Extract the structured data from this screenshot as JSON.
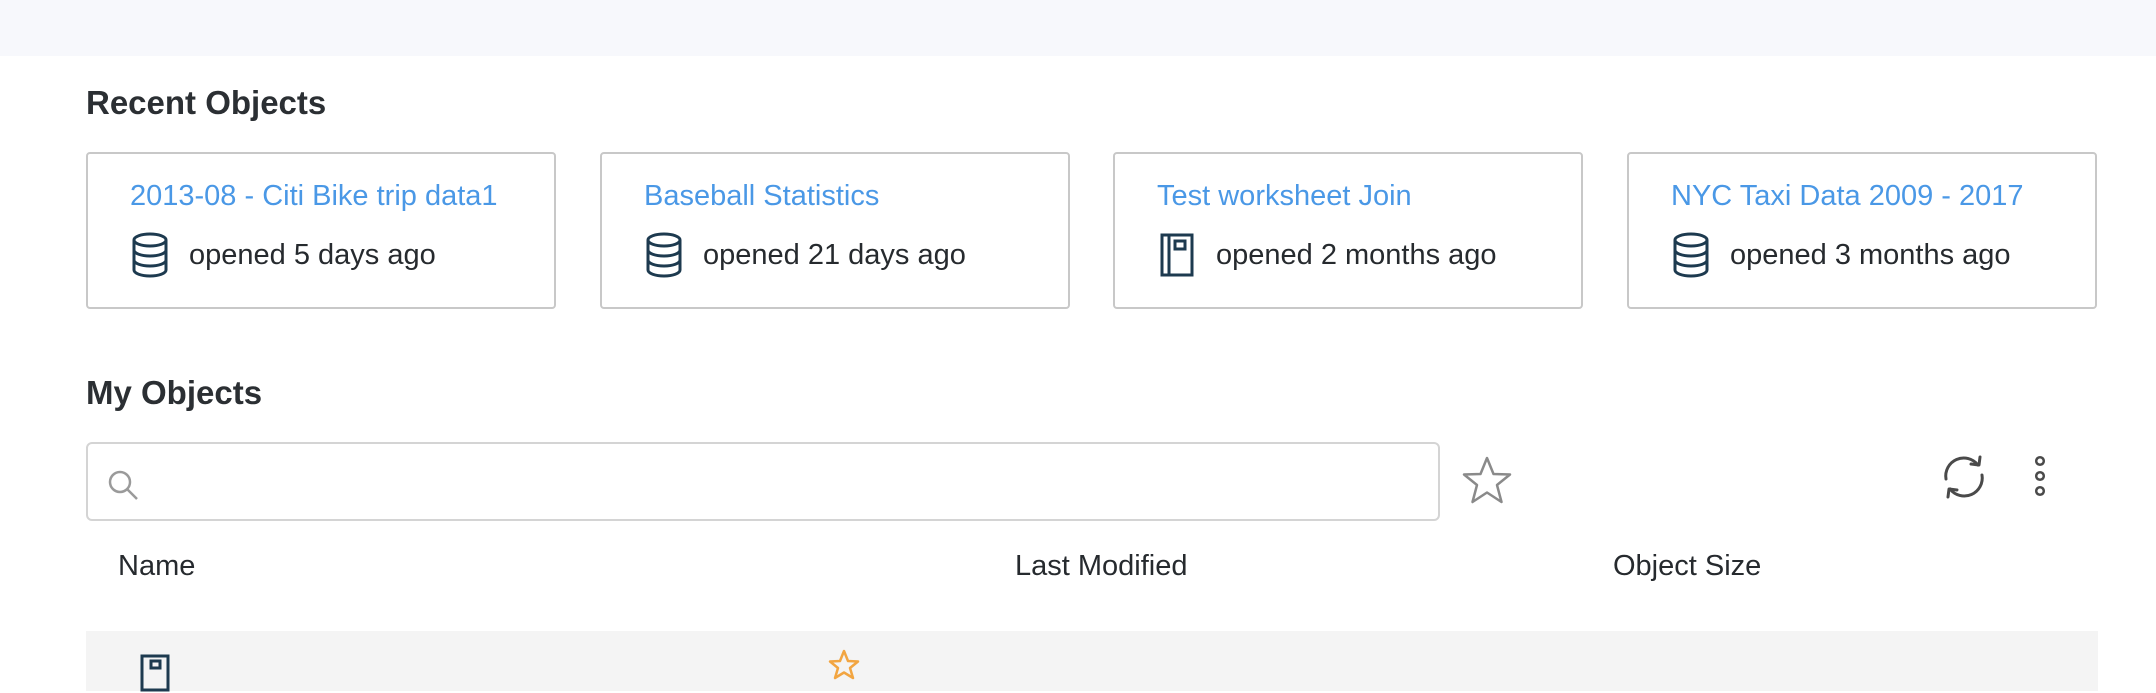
{
  "recent": {
    "title": "Recent Objects",
    "items": [
      {
        "name": "2013-08 - Citi Bike trip data1",
        "opened": "opened 5 days ago",
        "icon": "database-icon"
      },
      {
        "name": "Baseball Statistics",
        "opened": "opened 21 days ago",
        "icon": "database-icon"
      },
      {
        "name": "Test worksheet Join",
        "opened": "opened 2 months ago",
        "icon": "notebook-icon"
      },
      {
        "name": "NYC Taxi Data 2009 - 2017",
        "opened": "opened 3 months ago",
        "icon": "database-icon"
      }
    ]
  },
  "my_objects": {
    "title": "My Objects",
    "search": {
      "placeholder": "",
      "value": ""
    },
    "table": {
      "headers": [
        "Name",
        "Last Modified",
        "Object Size"
      ]
    }
  },
  "colors": {
    "link": "#4a98e6",
    "icon_dark": "#1d3a4f",
    "favorite_star": "#f2a541",
    "topbar": "#f7f8fc"
  }
}
